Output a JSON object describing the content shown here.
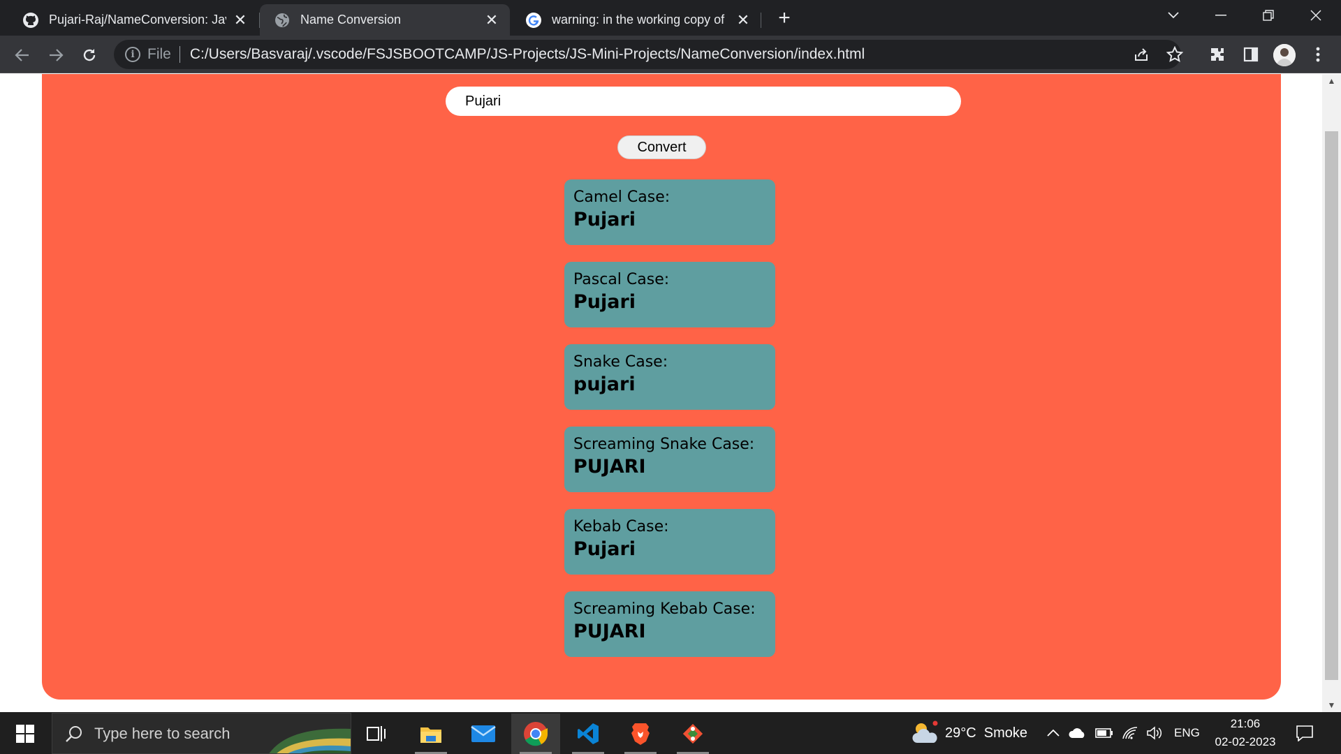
{
  "browser": {
    "tabs": [
      {
        "title": "Pujari-Raj/NameConversion: Java",
        "favicon": "github-icon",
        "active": false
      },
      {
        "title": "Name Conversion",
        "favicon": "globe-icon",
        "active": true
      },
      {
        "title": "warning: in the working copy of",
        "favicon": "google-icon",
        "active": false
      }
    ],
    "new_tab_label": "+",
    "address": {
      "scheme_label": "File",
      "url": "C:/Users/Basvaraj/.vscode/FSJSBOOTCAMP/JS-Projects/JS-Mini-Projects/NameConversion/index.html"
    }
  },
  "app": {
    "input_value": "Pujari",
    "convert_label": "Convert",
    "results": [
      {
        "label": "Camel Case:",
        "value": "Pujari"
      },
      {
        "label": "Pascal Case:",
        "value": "Pujari"
      },
      {
        "label": "Snake Case:",
        "value": "pujari"
      },
      {
        "label": "Screaming Snake Case:",
        "value": "PUJARI"
      },
      {
        "label": "Kebab Case:",
        "value": "Pujari"
      },
      {
        "label": "Screaming Kebab Case:",
        "value": "PUJARI"
      }
    ],
    "colors": {
      "background": "#ff6347",
      "result_card": "#5f9ea0"
    }
  },
  "taskbar": {
    "search_placeholder": "Type here to search",
    "apps": [
      "task-view-icon",
      "file-explorer-icon",
      "mail-icon",
      "chrome-icon",
      "vscode-icon",
      "brave-icon",
      "git-icon"
    ],
    "weather": "29°C  Smoke",
    "language": "ENG",
    "time": "21:06",
    "date": "02-02-2023"
  }
}
